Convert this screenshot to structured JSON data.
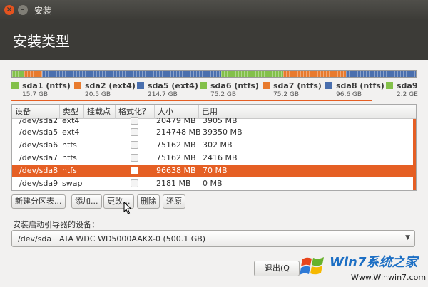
{
  "window": {
    "title": "安装"
  },
  "header": {
    "title": "安装类型"
  },
  "partition_bar": {
    "segments": [
      {
        "color": "#83c04a",
        "fraction": 0.03
      },
      {
        "color": "#e87a2d",
        "fraction": 0.044
      },
      {
        "color": "#4a6fae",
        "fraction": 0.443
      },
      {
        "color": "#83c04a",
        "fraction": 0.155
      },
      {
        "color": "#e87a2d",
        "fraction": 0.155
      },
      {
        "color": "#4a6fae",
        "fraction": 0.173
      }
    ]
  },
  "legend": [
    {
      "name": "sda1 (ntfs)",
      "size": "15.7 GB",
      "color": "#83c04a"
    },
    {
      "name": "sda2 (ext4)",
      "size": "20.5 GB",
      "color": "#e87a2d"
    },
    {
      "name": "sda5 (ext4)",
      "size": "214.7 GB",
      "color": "#4a6fae"
    },
    {
      "name": "sda6 (ntfs)",
      "size": "75.2 GB",
      "color": "#83c04a"
    },
    {
      "name": "sda7 (ntfs)",
      "size": "75.2 GB",
      "color": "#e87a2d"
    },
    {
      "name": "sda8 (ntfs)",
      "size": "96.6 GB",
      "color": "#4a6fae"
    },
    {
      "name": "sda9",
      "size": "2.2 GE",
      "color": "#83c04a"
    }
  ],
  "table": {
    "headers": [
      "设备",
      "类型",
      "挂载点",
      "格式化？",
      "大小",
      "已用"
    ],
    "rows": [
      {
        "device": "/dev/sda2",
        "type": "ext4",
        "mount": "",
        "size": "20479 MB",
        "used": "3905 MB",
        "selected": false
      },
      {
        "device": "/dev/sda5",
        "type": "ext4",
        "mount": "",
        "size": "214748 MB",
        "used": "39350 MB",
        "selected": false
      },
      {
        "device": "/dev/sda6",
        "type": "ntfs",
        "mount": "",
        "size": "75162 MB",
        "used": "302 MB",
        "selected": false
      },
      {
        "device": "/dev/sda7",
        "type": "ntfs",
        "mount": "",
        "size": "75162 MB",
        "used": "2416 MB",
        "selected": false
      },
      {
        "device": "/dev/sda8",
        "type": "ntfs",
        "mount": "",
        "size": "96638 MB",
        "used": "70 MB",
        "selected": true
      },
      {
        "device": "/dev/sda9",
        "type": "swap",
        "mount": "",
        "size": "2181 MB",
        "used": "0 MB",
        "selected": false
      }
    ]
  },
  "buttons": {
    "new_partition_table": "新建分区表...",
    "add": "添加...",
    "change": "更改...",
    "delete": "删除",
    "revert": "还原"
  },
  "bootloader": {
    "label": "安装启动引导器的设备：",
    "device": "/dev/sda",
    "model": "ATA WDC WD5000AAKX-0 (500.1 GB)"
  },
  "footer": {
    "quit": "退出(Q"
  },
  "watermark": {
    "brand": "Win7系统之家",
    "url": "Www.Winwin7.com"
  }
}
